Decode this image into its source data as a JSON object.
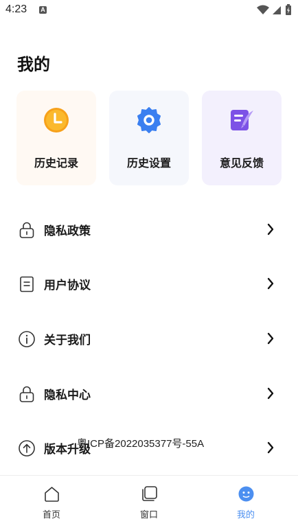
{
  "status_bar": {
    "time": "4:23",
    "notification_letter": "A"
  },
  "page": {
    "title": "我的"
  },
  "cards": [
    {
      "label": "历史记录",
      "icon": "clock-icon",
      "bg": "#fff9f3"
    },
    {
      "label": "历史设置",
      "icon": "gear-icon",
      "bg": "#f5f7fc"
    },
    {
      "label": "意见反馈",
      "icon": "feedback-icon",
      "bg": "#f3f0fd"
    }
  ],
  "menu": [
    {
      "label": "隐私政策",
      "icon": "lock-icon"
    },
    {
      "label": "用户协议",
      "icon": "document-icon"
    },
    {
      "label": "关于我们",
      "icon": "info-icon"
    },
    {
      "label": "隐私中心",
      "icon": "lock-icon"
    },
    {
      "label": "版本升级",
      "icon": "upgrade-icon"
    }
  ],
  "icp": "粤ICP备2022035377号-55A",
  "tabs": [
    {
      "label": "首页",
      "icon": "home-icon"
    },
    {
      "label": "窗口",
      "icon": "windows-icon"
    },
    {
      "label": "我的",
      "icon": "profile-icon",
      "active": true
    }
  ],
  "colors": {
    "accent": "#4c8ff0",
    "clock": "#f7a11a",
    "gear": "#3a7ff0",
    "feedback": "#7d52e6"
  }
}
